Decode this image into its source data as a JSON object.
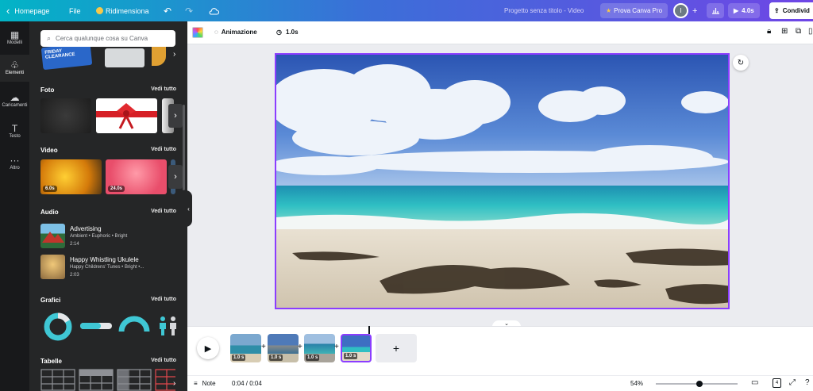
{
  "topbar": {
    "home": "Homepage",
    "file": "File",
    "resize": "Ridimensiona",
    "project_title": "Progetto senza titolo - Video",
    "try_pro": "Prova Canva Pro",
    "avatar_initial": "I",
    "play_duration": "4.0s",
    "share": "Condivid"
  },
  "rail": {
    "items": [
      {
        "label": "Modelli",
        "icon": "templates-icon"
      },
      {
        "label": "Elementi",
        "icon": "elements-icon"
      },
      {
        "label": "Caricamenti",
        "icon": "upload-icon"
      },
      {
        "label": "Testo",
        "icon": "text-icon"
      },
      {
        "label": "Altro",
        "icon": "more-icon"
      }
    ]
  },
  "panel": {
    "search_placeholder": "Cerca qualunque cosa su Canva",
    "top_stickers": [
      "FRIDAY CLEARANCE"
    ],
    "sections": {
      "photos": {
        "title": "Foto",
        "see_all": "Vedi tutto"
      },
      "videos": {
        "title": "Video",
        "see_all": "Vedi tutto",
        "durations": [
          "6.0s",
          "24.0s"
        ]
      },
      "audio": {
        "title": "Audio",
        "see_all": "Vedi tutto"
      },
      "charts": {
        "title": "Grafici",
        "see_all": "Vedi tutto"
      },
      "tables": {
        "title": "Tabelle",
        "see_all": "Vedi tutto"
      }
    },
    "audio_tracks": [
      {
        "title": "Advertising",
        "tags": "Ambient • Euphoric • Bright",
        "duration": "2:14"
      },
      {
        "title": "Happy Whistling Ukulele",
        "tags": "Happy Childrens' Tunes • Bright •...",
        "duration": "2:03"
      }
    ]
  },
  "editor": {
    "animation": "Animazione",
    "duration": "1.0s"
  },
  "timeline": {
    "clips": [
      "1.0 s",
      "1.0 s",
      "1.0 s",
      "1.0 s"
    ],
    "add": "+"
  },
  "bottom": {
    "notes": "Note",
    "time": "0:04 / 0:04",
    "zoom": "54%",
    "zoom_level": 0.54,
    "page_count": "4"
  },
  "colors": {
    "accent": "#8b3dff",
    "gradient_start": "#02b4c6",
    "gradient_end": "#6f46e6",
    "panel_bg": "#252627",
    "rail_bg": "#18191b"
  }
}
